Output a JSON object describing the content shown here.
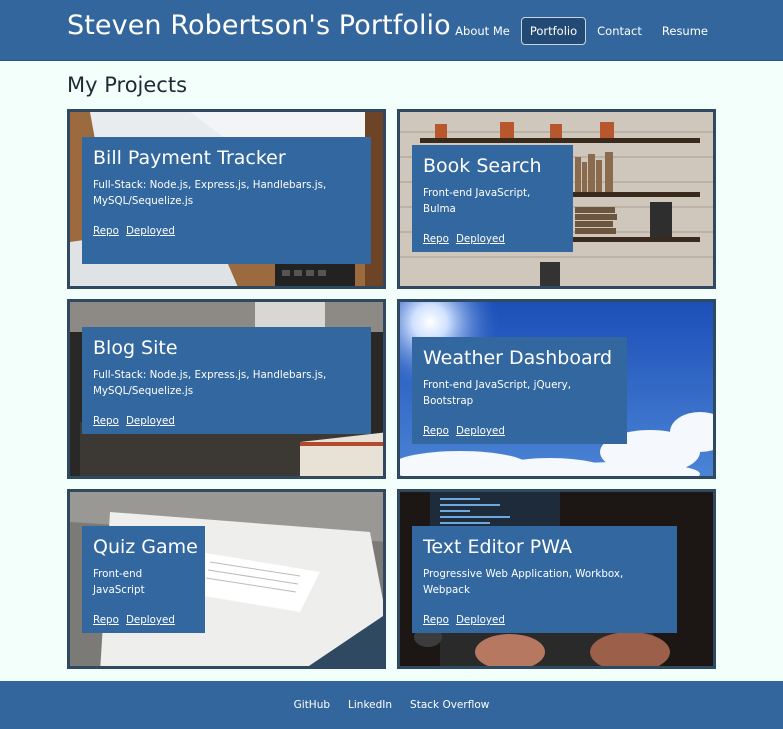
{
  "header": {
    "title": "Steven Robertson's Portfolio",
    "nav": {
      "about": "About Me",
      "portfolio": "Portfolio",
      "contact": "Contact",
      "resume": "Resume"
    }
  },
  "main": {
    "heading": "My Projects",
    "projects": [
      {
        "title": "Bill Payment Tracker",
        "tech": "Full-Stack: Node.js, Express.js, Handlebars.js, MySQL/Sequelize.js",
        "repo_label": "Repo",
        "deployed_label": "Deployed"
      },
      {
        "title": "Book Search",
        "tech": "Front-end JavaScript, Bulma",
        "repo_label": "Repo",
        "deployed_label": "Deployed"
      },
      {
        "title": "Blog Site",
        "tech": "Full-Stack: Node.js, Express.js, Handlebars.js, MySQL/Sequelize.js",
        "repo_label": "Repo",
        "deployed_label": "Deployed"
      },
      {
        "title": "Weather Dashboard",
        "tech": "Front-end JavaScript, jQuery, Bootstrap",
        "repo_label": "Repo",
        "deployed_label": "Deployed"
      },
      {
        "title": "Quiz Game",
        "tech": "Front-end JavaScript",
        "repo_label": "Repo",
        "deployed_label": "Deployed"
      },
      {
        "title": "Text Editor PWA",
        "tech": "Progressive Web Application, Workbox, Webpack",
        "repo_label": "Repo",
        "deployed_label": "Deployed"
      }
    ]
  },
  "footer": {
    "github": "GitHub",
    "linkedin": "LinkedIn",
    "stackoverflow": "Stack Overflow"
  },
  "colors": {
    "primary": "#33669c",
    "page_background": "#f3fffa",
    "card_border": "#2f4961"
  }
}
